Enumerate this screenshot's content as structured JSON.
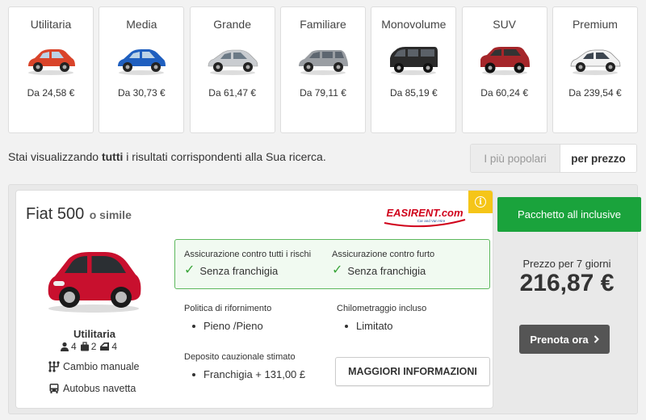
{
  "categories": [
    {
      "name": "Utilitaria",
      "price": "Da 24,58 €",
      "color": "#d9442a",
      "icon": "car-icon"
    },
    {
      "name": "Media",
      "price": "Da 30,73 €",
      "color": "#1f5fbf",
      "icon": "car-icon"
    },
    {
      "name": "Grande",
      "price": "Da 61,47 €",
      "color": "#c9ccd0",
      "icon": "car-icon"
    },
    {
      "name": "Familiare",
      "price": "Da 79,11 €",
      "color": "#9a9ea3",
      "icon": "car-icon"
    },
    {
      "name": "Monovolume",
      "price": "Da 85,19 €",
      "color": "#2a2a2a",
      "icon": "van-icon"
    },
    {
      "name": "SUV",
      "price": "Da 60,24 €",
      "color": "#a5262a",
      "icon": "suv-icon"
    },
    {
      "name": "Premium",
      "price": "Da 239,54 €",
      "color": "#f2f2f2",
      "icon": "car-icon"
    }
  ],
  "results": {
    "prefix": "Stai visualizzando ",
    "highlight": "tutti",
    "suffix": " i risultati corrispondenti alla Sua ricerca."
  },
  "sort": {
    "popular": "I più popolari",
    "price": "per prezzo",
    "active": "price"
  },
  "offer": {
    "model": "Fiat 500",
    "similar": "o simile",
    "supplier_logo_text": "EASIRENT.com",
    "supplier_logo_tagline": "Car and Van Hire",
    "car_color": "#c8102e",
    "category": "Utilitaria",
    "specs": {
      "passengers": "4",
      "bags": "2",
      "doors": "4"
    },
    "transmission": "Cambio manuale",
    "shuttle": "Autobus navetta",
    "insurance": [
      {
        "title": "Assicurazione contro tutti i rischi",
        "value": "Senza franchigia"
      },
      {
        "title": "Assicurazione contro furto",
        "value": "Senza franchigia"
      }
    ],
    "fuel_policy": {
      "title": "Politica di rifornimento",
      "value": "Pieno /Pieno"
    },
    "mileage": {
      "title": "Chilometraggio incluso",
      "value": "Limitato"
    },
    "deposit": {
      "title": "Deposito cauzionale stimato",
      "value": "Franchigia + 131,00 £"
    },
    "more_info": "MAGGIORI INFORMAZIONI",
    "package": "Pacchetto all inclusive",
    "price_label": "Prezzo per 7 giorni",
    "price": "216,87 €",
    "book": "Prenota ora"
  },
  "colors": {
    "accent_green": "#1aa33c",
    "info_yellow": "#f5c518",
    "button_dark": "#555555",
    "logo_red": "#d0021b",
    "logo_blue": "#1e4f9c"
  }
}
